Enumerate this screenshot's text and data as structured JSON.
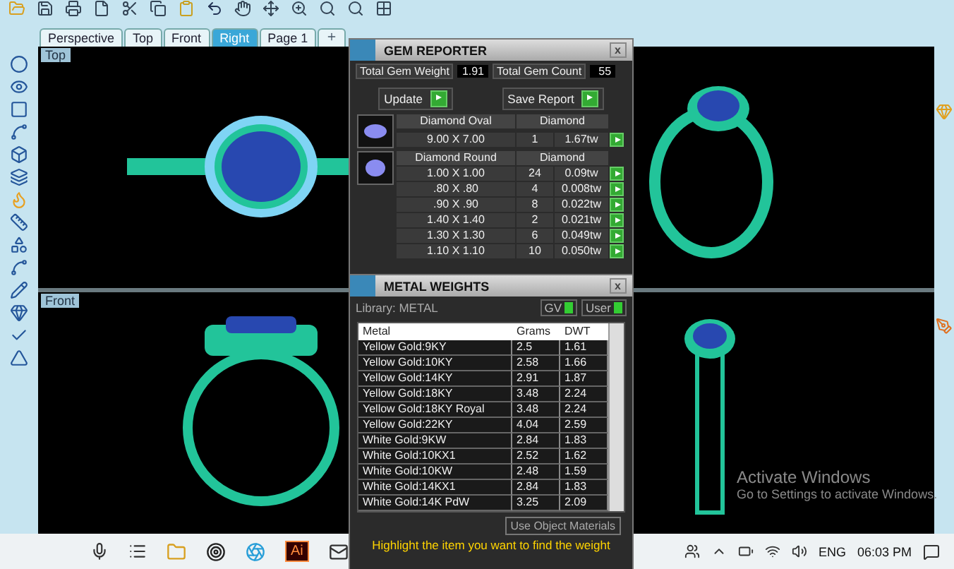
{
  "tabs": [
    {
      "label": "Perspective",
      "selected": false
    },
    {
      "label": "Top",
      "selected": false
    },
    {
      "label": "Front",
      "selected": false
    },
    {
      "label": "Right",
      "selected": true
    },
    {
      "label": "Page 1",
      "selected": false
    }
  ],
  "viewports": [
    {
      "kind": "top",
      "label": "Top"
    },
    {
      "kind": "perspective"
    },
    {
      "kind": "front",
      "label": "Front"
    },
    {
      "kind": "side"
    }
  ],
  "gem_reporter": {
    "title": "GEM REPORTER",
    "close": "x",
    "total_weight_label": "Total Gem Weight",
    "total_weight": "1.91",
    "total_count_label": "Total Gem Count",
    "total_count": "55",
    "buttons": [
      "Update",
      "Save Report"
    ],
    "groups": [
      {
        "kind": "oval",
        "shape": "Diamond Oval",
        "material": "Diamond",
        "rows": [
          {
            "size": "9.00 X 7.00",
            "count": "1",
            "weight": "1.67tw"
          }
        ]
      },
      {
        "kind": "round",
        "shape": "Diamond Round",
        "material": "Diamond",
        "rows": [
          {
            "size": "1.00 X 1.00",
            "count": "24",
            "weight": "0.09tw"
          },
          {
            "size": ".80 X .80",
            "count": "4",
            "weight": "0.008tw"
          },
          {
            "size": ".90 X .90",
            "count": "8",
            "weight": "0.022tw"
          },
          {
            "size": "1.40 X 1.40",
            "count": "2",
            "weight": "0.021tw"
          },
          {
            "size": "1.30 X 1.30",
            "count": "6",
            "weight": "0.049tw"
          },
          {
            "size": "1.10 X 1.10",
            "count": "10",
            "weight": "0.050tw"
          }
        ]
      }
    ]
  },
  "metal_weights": {
    "title": "METAL WEIGHTS",
    "close": "x",
    "library": "Library: METAL",
    "toggles": [
      {
        "label": "GV",
        "on": true
      },
      {
        "label": "User",
        "on": true
      }
    ],
    "columns": [
      "Metal",
      "Grams",
      "DWT"
    ],
    "rows": [
      [
        "Yellow Gold:9KY",
        "2.5",
        "1.61"
      ],
      [
        "Yellow Gold:10KY",
        "2.58",
        "1.66"
      ],
      [
        "Yellow Gold:14KY",
        "2.91",
        "1.87"
      ],
      [
        "Yellow Gold:18KY",
        "3.48",
        "2.24"
      ],
      [
        "Yellow Gold:18KY Royal",
        "3.48",
        "2.24"
      ],
      [
        "Yellow Gold:22KY",
        "4.04",
        "2.59"
      ],
      [
        "White Gold:9KW",
        "2.84",
        "1.83"
      ],
      [
        "White Gold:10KX1",
        "2.52",
        "1.62"
      ],
      [
        "White Gold:10KW",
        "2.48",
        "1.59"
      ],
      [
        "White Gold:14KX1",
        "2.84",
        "1.83"
      ],
      [
        "White Gold:14K PdW",
        "3.25",
        "2.09"
      ]
    ],
    "use_object_materials": "Use Object Materials",
    "hint": "Highlight the item you want to find the weight"
  },
  "activation": {
    "title": "Activate Windows",
    "subtitle": "Go to Settings to activate Windows."
  },
  "taskbar": {
    "app_label": "Ai",
    "language": "ENG",
    "time": "06:03 PM"
  }
}
